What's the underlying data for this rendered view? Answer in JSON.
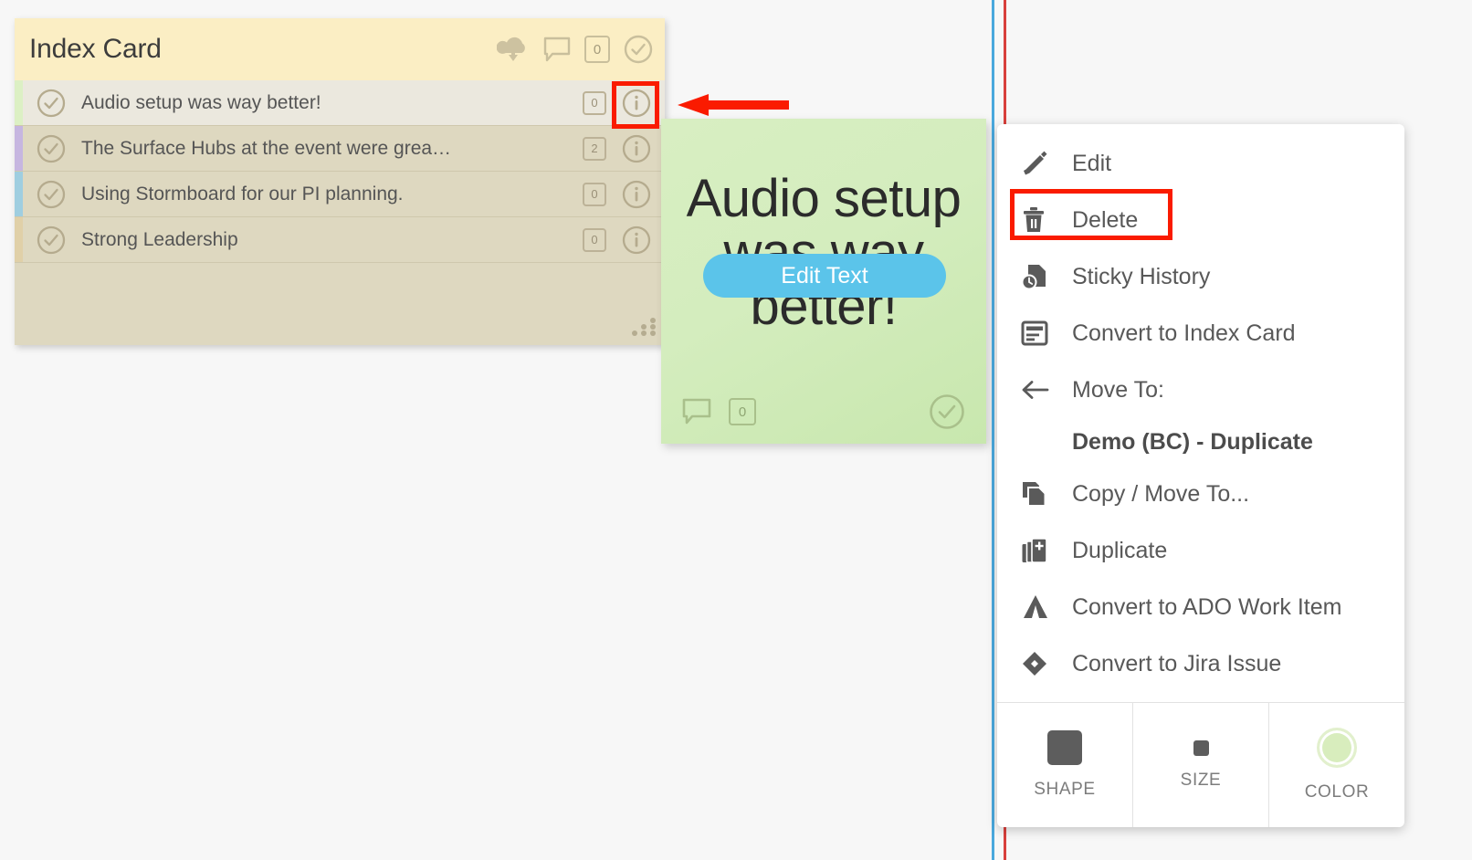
{
  "app": {
    "background_color": "#f7f7f7",
    "highlight_color": "#fa1b00",
    "guide_blue": "#4aa8dd",
    "guide_red": "#d8403c"
  },
  "index_card": {
    "title": "Index Card",
    "header_color": "#fbeec4",
    "body_color": "#ded8c0",
    "header_icons": [
      {
        "name": "cloud-download-icon",
        "label": "Cloud download"
      },
      {
        "name": "comment-icon",
        "label": "Comments"
      },
      {
        "name": "vote-count-box",
        "label": "0"
      },
      {
        "name": "check-circle-icon",
        "label": "Complete"
      }
    ],
    "rows": [
      {
        "label": "Audio setup was way better!",
        "count": "0",
        "strip_color": "#dcf0c4",
        "selected": true
      },
      {
        "label": "The Surface Hubs at the event were grea…",
        "count": "2",
        "strip_color": "#c6b6e0",
        "selected": false
      },
      {
        "label": "Using Stormboard for our PI planning.",
        "count": "0",
        "strip_color": "#9fcee0",
        "selected": false
      },
      {
        "label": "Strong Leadership",
        "count": "0",
        "strip_color": "#e0d0a8",
        "selected": false
      }
    ],
    "resize_handle": "resize-handle"
  },
  "sticky_note": {
    "text": "Audio setup was way better!",
    "color": "#d4edbe",
    "edit_button_label": "Edit Text",
    "edit_button_color": "#5bc4ea",
    "footer": {
      "comment_icon": "comment-icon",
      "count": "0",
      "check_icon": "check-circle-icon"
    }
  },
  "context_menu": {
    "items": [
      {
        "label": "Edit",
        "icon": "pencil-icon",
        "highlighted": false
      },
      {
        "label": "Delete",
        "icon": "trash-icon",
        "highlighted": true
      },
      {
        "label": "Sticky History",
        "icon": "history-document-icon",
        "highlighted": false
      },
      {
        "label": "Convert to Index Card",
        "icon": "index-card-icon",
        "highlighted": false
      },
      {
        "label": "Move To:",
        "icon": "arrow-left-icon",
        "highlighted": false
      }
    ],
    "move_to_target": "Demo (BC) - Duplicate",
    "items_after": [
      {
        "label": "Copy / Move To...",
        "icon": "copy-icon"
      },
      {
        "label": "Duplicate",
        "icon": "duplicate-plus-icon"
      },
      {
        "label": "Convert to ADO Work Item",
        "icon": "azure-devops-icon"
      },
      {
        "label": "Convert to Jira Issue",
        "icon": "jira-diamond-icon"
      }
    ],
    "toolbar": [
      {
        "label": "SHAPE",
        "icon": "square-shape-icon"
      },
      {
        "label": "SIZE",
        "icon": "small-square-size-icon"
      },
      {
        "label": "COLOR",
        "icon": "color-circle-icon",
        "color": "#d8edbd"
      }
    ]
  },
  "annotations": {
    "info_icon_highlight": "info-icon",
    "arrow_direction": "left"
  }
}
